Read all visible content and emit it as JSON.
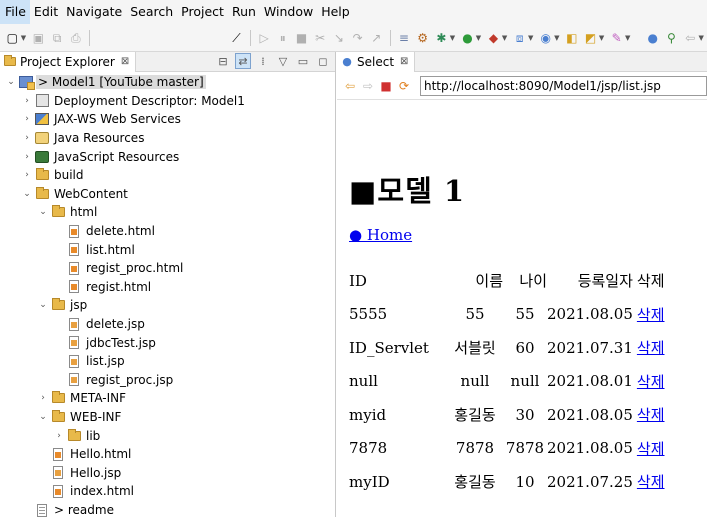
{
  "menubar": {
    "items": [
      "File",
      "Edit",
      "Navigate",
      "Search",
      "Project",
      "Run",
      "Window",
      "Help"
    ]
  },
  "toolbar": {
    "icons": [
      "new-icon",
      "save-icon",
      "save-all-icon",
      "print-icon",
      "skip-breakpoints-icon",
      "resume-icon",
      "suspend-icon",
      "terminate-icon",
      "disconnect-icon",
      "step-into-icon",
      "step-over-icon",
      "step-return-icon",
      "drop-to-frame-icon",
      "use-step-filters-icon",
      "debug-icon",
      "run-icon",
      "coverage-icon",
      "external-tools-icon",
      "new-java-project-icon",
      "new-package-icon",
      "new-class-icon",
      "open-type-icon",
      "search-icon",
      "open-task-icon",
      "annotation-nav-icon",
      "back-icon"
    ]
  },
  "explorer": {
    "title": "Project Explorer",
    "close": "⊠",
    "rows": [
      {
        "label": "> Model1  [YouTube master]",
        "depth": 0,
        "twisty": "open",
        "icon": "project-icon",
        "selected": true
      },
      {
        "label": "Deployment Descriptor: Model1",
        "depth": 1,
        "twisty": "closed",
        "icon": "deployment-descriptor-icon"
      },
      {
        "label": "JAX-WS Web Services",
        "depth": 1,
        "twisty": "closed",
        "icon": "web-services-icon"
      },
      {
        "label": "Java Resources",
        "depth": 1,
        "twisty": "closed",
        "icon": "java-resources-icon"
      },
      {
        "label": "JavaScript Resources",
        "depth": 1,
        "twisty": "closed",
        "icon": "javascript-resources-icon"
      },
      {
        "label": "build",
        "depth": 1,
        "twisty": "closed",
        "icon": "folder-icon"
      },
      {
        "label": "WebContent",
        "depth": 1,
        "twisty": "open",
        "icon": "folder-icon"
      },
      {
        "label": "html",
        "depth": 2,
        "twisty": "open",
        "icon": "folder-icon"
      },
      {
        "label": "delete.html",
        "depth": 3,
        "twisty": "none",
        "icon": "html-file-icon"
      },
      {
        "label": "list.html",
        "depth": 3,
        "twisty": "none",
        "icon": "html-file-icon"
      },
      {
        "label": "regist_proc.html",
        "depth": 3,
        "twisty": "none",
        "icon": "html-file-icon"
      },
      {
        "label": "regist.html",
        "depth": 3,
        "twisty": "none",
        "icon": "html-file-icon"
      },
      {
        "label": "jsp",
        "depth": 2,
        "twisty": "open",
        "icon": "folder-icon"
      },
      {
        "label": "delete.jsp",
        "depth": 3,
        "twisty": "none",
        "icon": "jsp-file-icon"
      },
      {
        "label": "jdbcTest.jsp",
        "depth": 3,
        "twisty": "none",
        "icon": "jsp-file-icon"
      },
      {
        "label": "list.jsp",
        "depth": 3,
        "twisty": "none",
        "icon": "jsp-file-icon"
      },
      {
        "label": "regist_proc.jsp",
        "depth": 3,
        "twisty": "none",
        "icon": "jsp-file-icon"
      },
      {
        "label": "META-INF",
        "depth": 2,
        "twisty": "closed",
        "icon": "folder-icon"
      },
      {
        "label": "WEB-INF",
        "depth": 2,
        "twisty": "open",
        "icon": "folder-icon"
      },
      {
        "label": "lib",
        "depth": 3,
        "twisty": "closed",
        "icon": "folder-icon"
      },
      {
        "label": "Hello.html",
        "depth": 2,
        "twisty": "none",
        "icon": "html-file-icon"
      },
      {
        "label": "Hello.jsp",
        "depth": 2,
        "twisty": "none",
        "icon": "jsp-file-icon"
      },
      {
        "label": "index.html",
        "depth": 2,
        "twisty": "none",
        "icon": "html-file-icon"
      },
      {
        "label": "> readme",
        "depth": 1,
        "twisty": "none",
        "icon": "readme-file-icon"
      }
    ]
  },
  "browser": {
    "tab_title": "Select",
    "close": "⊠",
    "url": "http://localhost:8090/Model1/jsp/list.jsp",
    "page": {
      "heading": "■모델 1",
      "home_link": "● Home",
      "columns": [
        "ID",
        "이름",
        "나이",
        "등록일자",
        "삭제"
      ],
      "rows": [
        [
          "5555",
          "55",
          "55",
          "2021.08.05",
          "삭제"
        ],
        [
          "ID_Servlet",
          "서블릿",
          "60",
          "2021.07.31",
          "삭제"
        ],
        [
          "null",
          "null",
          "null",
          "2021.08.01",
          "삭제"
        ],
        [
          "myid",
          "홍길동",
          "30",
          "2021.08.05",
          "삭제"
        ],
        [
          "7878",
          "7878",
          "7878",
          "2021.08.05",
          "삭제"
        ],
        [
          "myID",
          "홍길동",
          "10",
          "2021.07.25",
          "삭제"
        ]
      ]
    }
  }
}
